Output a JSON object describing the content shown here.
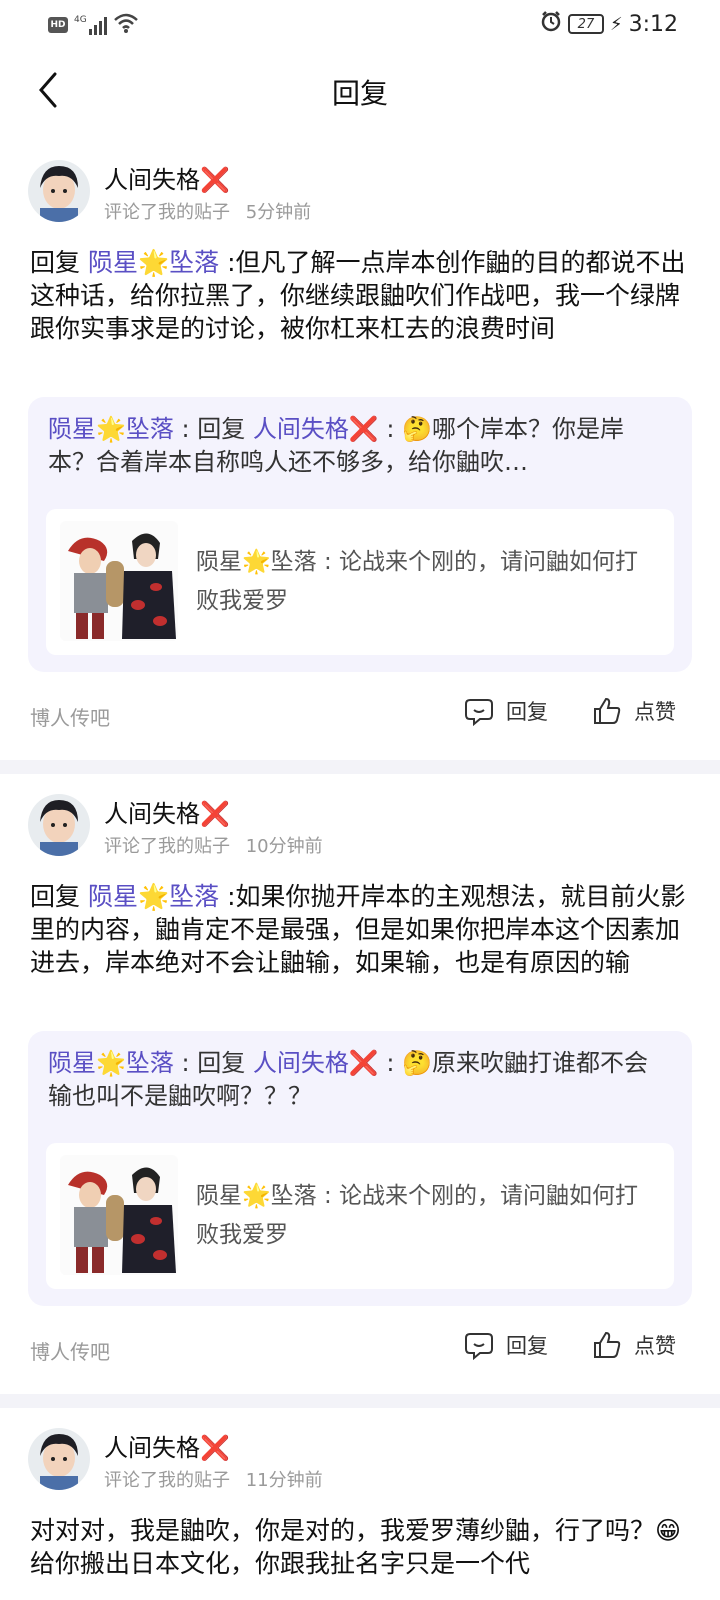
{
  "status_bar": {
    "network": "4G",
    "battery": "27",
    "time": "3:12"
  },
  "nav": {
    "title": "回复"
  },
  "items": [
    {
      "user": "人间失格❌",
      "action": "评论了我的贴子",
      "time": "5分钟前",
      "reply_prefix": "回复",
      "mention": "陨星🌟坠落",
      "text": ":但凡了解一点岸本创作鼬的目的都说不出这种话，给你拉黑了，你继续跟鼬吹们作战吧，我一个绿牌跟你实事求是的讨论，被你杠来杠去的浪费时间",
      "quote_user": "陨星🌟坠落",
      "quote_sep": " : 回复 ",
      "quote_mention": "人间失格❌",
      "quote_text": " : 🤔哪个岸本？你是岸本？合着岸本自称鸣人还不够多，给你鼬吹…",
      "post_user": "陨星🌟坠落",
      "post_text": " : 论战来个刚的，请问鼬如何打败我爱罗",
      "forum": "博人传吧",
      "reply_label": "回复",
      "like_label": "点赞"
    },
    {
      "user": "人间失格❌",
      "action": "评论了我的贴子",
      "time": "10分钟前",
      "reply_prefix": "回复",
      "mention": "陨星🌟坠落",
      "text": ":如果你抛开岸本的主观想法，就目前火影里的内容，鼬肯定不是最强，但是如果你把岸本这个因素加进去，岸本绝对不会让鼬输，如果输，也是有原因的输",
      "quote_user": "陨星🌟坠落",
      "quote_sep": " : 回复 ",
      "quote_mention": "人间失格❌",
      "quote_text": " : 🤔原来吹鼬打谁都不会输也叫不是鼬吹啊？？？",
      "post_user": "陨星🌟坠落",
      "post_text": " : 论战来个刚的，请问鼬如何打败我爱罗",
      "forum": "博人传吧",
      "reply_label": "回复",
      "like_label": "点赞"
    },
    {
      "user": "人间失格❌",
      "action": "评论了我的贴子",
      "time": "11分钟前",
      "text": "对对对，我是鼬吹，你是对的，我爱罗薄纱鼬，行了吗？😁给你搬出日本文化，你跟我扯名字只是一个代"
    }
  ],
  "colors": {
    "accent": "#5a4fc4",
    "quote_bg": "#f4f3fd",
    "divider": "#f3f3f8",
    "muted": "#9a9a9a"
  }
}
